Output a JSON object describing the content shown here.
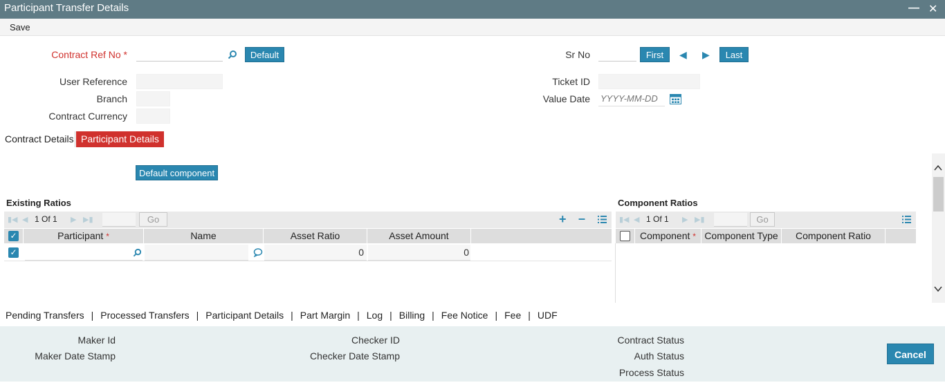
{
  "window": {
    "title": "Participant Transfer Details"
  },
  "menu": {
    "save_label": "Save"
  },
  "header": {
    "contract_ref_label": "Contract Ref No",
    "required_mark": "*",
    "default_button": "Default",
    "user_reference_label": "User Reference",
    "branch_label": "Branch",
    "contract_currency_label": "Contract Currency",
    "sr_no_label": "Sr No",
    "first_button": "First",
    "last_button": "Last",
    "ticket_id_label": "Ticket ID",
    "value_date_label": "Value Date",
    "value_date_placeholder": "YYYY-MM-DD"
  },
  "tabs": [
    {
      "label": "Contract Details",
      "active": false
    },
    {
      "label": "Participant Details",
      "active": true
    }
  ],
  "body": {
    "default_component_button": "Default component",
    "existing_ratios": {
      "title": "Existing Ratios",
      "pager": {
        "current": "1",
        "of_label": "Of",
        "total": "1",
        "go_label": "Go"
      },
      "columns": [
        "Participant",
        "Name",
        "Asset Ratio",
        "Asset Amount"
      ],
      "required_mark": "*",
      "rows": [
        {
          "participant": "",
          "name": "",
          "asset_ratio": "0",
          "asset_amount": "0"
        }
      ]
    },
    "component_ratios": {
      "title": "Component Ratios",
      "pager": {
        "current": "1",
        "of_label": "Of",
        "total": "1",
        "go_label": "Go"
      },
      "columns": [
        "Component",
        "Component Type",
        "Component Ratio"
      ],
      "required_mark": "*"
    }
  },
  "bottom_links": [
    "Pending Transfers",
    "Processed Transfers",
    "Participant Details",
    "Part Margin",
    "Log",
    "Billing",
    "Fee Notice",
    "Fee",
    "UDF"
  ],
  "bottom_link_separator": "|",
  "footer": {
    "maker_id_label": "Maker Id",
    "maker_date_stamp_label": "Maker Date Stamp",
    "checker_id_label": "Checker ID",
    "checker_date_stamp_label": "Checker Date Stamp",
    "contract_status_label": "Contract Status",
    "auth_status_label": "Auth Status",
    "process_status_label": "Process Status",
    "cancel_button": "Cancel"
  },
  "colors": {
    "accent": "#2a87b0",
    "active_tab": "#d0312d",
    "titlebar": "#5f7b85",
    "footer_bg": "#e8f0f1"
  }
}
